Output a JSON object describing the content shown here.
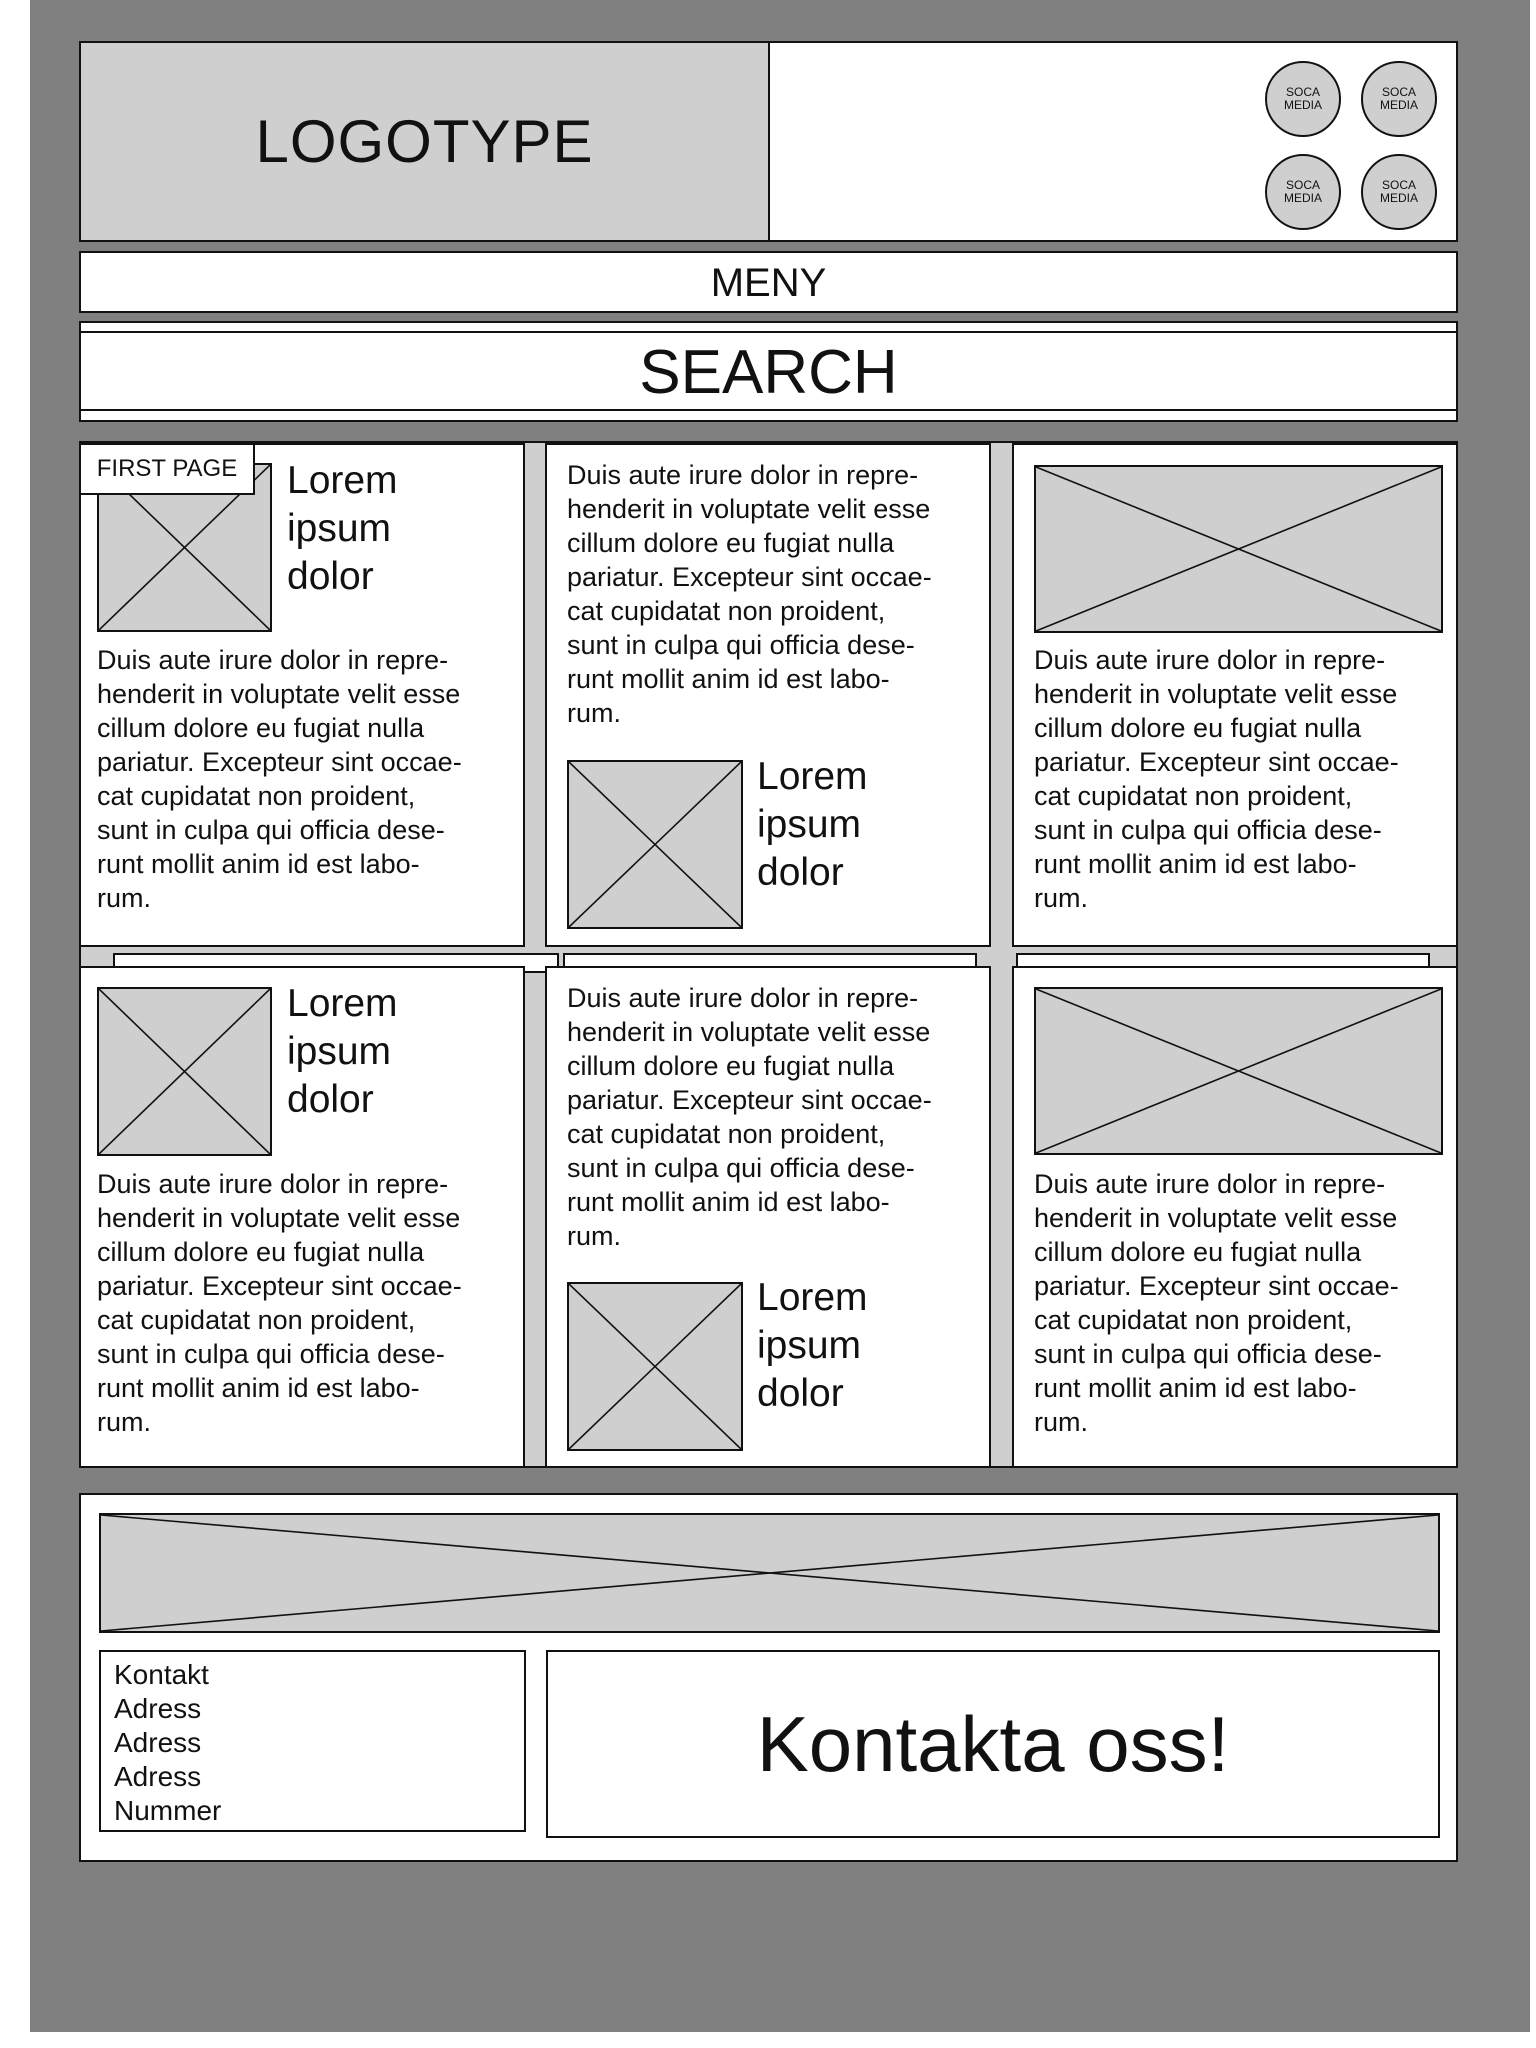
{
  "header": {
    "logo": "LOGOTYPE",
    "social_label": "SOCA\nMEDIA"
  },
  "menu": {
    "label": "MENY"
  },
  "search": {
    "label": "SEARCH"
  },
  "first_page_tag": "FIRST PAGE",
  "cards": {
    "title": "Lorem\nipsum\ndolor",
    "body": "Duis aute irure dolor in repre-\nhenderit in voluptate velit esse\ncillum dolore eu fugiat nulla\npariatur. Excepteur sint occae-\ncat cupidatat non proident,\nsunt in culpa qui officia dese-\nrunt mollit anim id est labo-\nrum."
  },
  "footer": {
    "contact_lines": [
      "Kontakt",
      "Adress",
      "Adress",
      "Adress",
      "Nummer"
    ],
    "cta": "Kontakta oss!"
  },
  "colors": {
    "page_background": "#808080",
    "placeholder_fill": "#cfcfcf",
    "panel": "#ffffff",
    "ink": "#111111"
  }
}
